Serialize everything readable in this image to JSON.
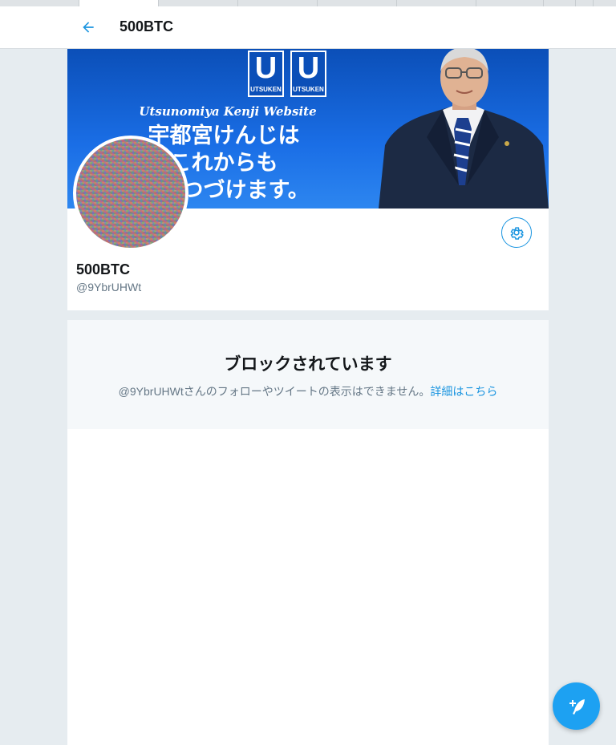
{
  "header": {
    "title": "500BTC"
  },
  "banner": {
    "logo_letter": "U",
    "logo_text": "UTSUKEN",
    "subtitle": "Utsunomiya Kenji Website",
    "headline_line1": "宇都宮けんじは",
    "headline_line2": "これからも",
    "headline_line3": "走りつづけます。"
  },
  "profile": {
    "name": "500BTC",
    "handle": "@9YbrUHWt"
  },
  "blocked": {
    "title": "ブロックされています",
    "description": "@9YbrUHWtさんのフォローやツイートの表示はできません。",
    "link_label": "詳細はこちら"
  },
  "colors": {
    "accent": "#1b95e0",
    "fab": "#1da1f2",
    "background": "#e6ecf0"
  },
  "icons": {
    "back": "arrow-left-icon",
    "settings": "gear-icon",
    "compose": "compose-tweet-icon"
  }
}
